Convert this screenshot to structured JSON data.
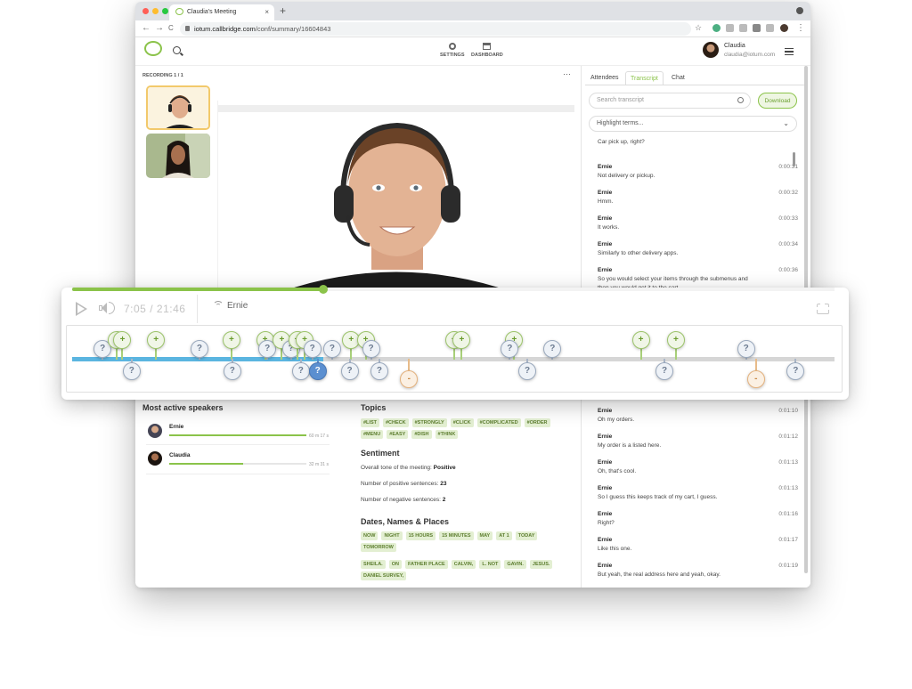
{
  "browser": {
    "tab_title": "Claudia's Meeting",
    "new_tab": "+",
    "url_host": "iotum.callbridge.com",
    "url_path": "/conf/summary/16604843",
    "nav_back": "←",
    "nav_forward": "→",
    "nav_reload": "C",
    "star": "☆",
    "more": "⋮",
    "tab_close": "×"
  },
  "header": {
    "settings_label": "SETTINGS",
    "dashboard_label": "DASHBOARD",
    "user_name": "Claudia",
    "user_email": "claudia@iotum.com"
  },
  "recording": {
    "label": "RECORDING 1 / 1",
    "more": "···"
  },
  "player": {
    "progress": 0.33,
    "current_time": "7:05",
    "separator": "/",
    "total_time": "21:46",
    "current_speaker": "Ernie"
  },
  "timeline": {
    "played_fraction": 0.33,
    "markers": [
      {
        "pos": 0.04,
        "kind": "q",
        "side": "up",
        "level": 1,
        "label": "?"
      },
      {
        "pos": 0.058,
        "kind": "plus",
        "side": "up",
        "level": 2,
        "label": "+"
      },
      {
        "pos": 0.066,
        "kind": "plus",
        "side": "up",
        "level": 2,
        "label": "+"
      },
      {
        "pos": 0.078,
        "kind": "q",
        "side": "down",
        "level": 1,
        "label": "?"
      },
      {
        "pos": 0.11,
        "kind": "plus",
        "side": "up",
        "level": 2,
        "label": "+"
      },
      {
        "pos": 0.167,
        "kind": "q",
        "side": "up",
        "level": 1,
        "label": "?"
      },
      {
        "pos": 0.209,
        "kind": "plus",
        "side": "up",
        "level": 2,
        "label": "+"
      },
      {
        "pos": 0.21,
        "kind": "q",
        "side": "down",
        "level": 1,
        "label": "?"
      },
      {
        "pos": 0.253,
        "kind": "plus",
        "side": "up",
        "level": 2,
        "label": "+"
      },
      {
        "pos": 0.256,
        "kind": "q",
        "side": "up",
        "level": 1,
        "label": "?"
      },
      {
        "pos": 0.275,
        "kind": "plus",
        "side": "up",
        "level": 2,
        "label": "+"
      },
      {
        "pos": 0.287,
        "kind": "q",
        "side": "up",
        "level": 1,
        "label": "?"
      },
      {
        "pos": 0.295,
        "kind": "plus",
        "side": "up",
        "level": 2,
        "label": "+"
      },
      {
        "pos": 0.3,
        "kind": "q",
        "side": "down",
        "level": 1,
        "label": "?"
      },
      {
        "pos": 0.305,
        "kind": "plus",
        "side": "up",
        "level": 2,
        "label": "+"
      },
      {
        "pos": 0.315,
        "kind": "q",
        "side": "up",
        "level": 1,
        "label": "?"
      },
      {
        "pos": 0.322,
        "kind": "sel",
        "side": "down",
        "level": 1,
        "label": "?"
      },
      {
        "pos": 0.341,
        "kind": "q",
        "side": "up",
        "level": 1,
        "label": "?"
      },
      {
        "pos": 0.366,
        "kind": "plus",
        "side": "up",
        "level": 2,
        "label": "+"
      },
      {
        "pos": 0.364,
        "kind": "q",
        "side": "down",
        "level": 1,
        "label": "?"
      },
      {
        "pos": 0.385,
        "kind": "plus",
        "side": "up",
        "level": 2,
        "label": "+"
      },
      {
        "pos": 0.392,
        "kind": "q",
        "side": "up",
        "level": 1,
        "label": "?"
      },
      {
        "pos": 0.403,
        "kind": "q",
        "side": "down",
        "level": 1,
        "label": "?"
      },
      {
        "pos": 0.442,
        "kind": "minus",
        "side": "down",
        "level": 1,
        "label": "-"
      },
      {
        "pos": 0.501,
        "kind": "plus",
        "side": "up",
        "level": 2,
        "label": "+"
      },
      {
        "pos": 0.511,
        "kind": "plus",
        "side": "up",
        "level": 2,
        "label": "+"
      },
      {
        "pos": 0.58,
        "kind": "plus",
        "side": "up",
        "level": 2,
        "label": "+"
      },
      {
        "pos": 0.574,
        "kind": "q",
        "side": "up",
        "level": 1,
        "label": "?"
      },
      {
        "pos": 0.597,
        "kind": "q",
        "side": "down",
        "level": 1,
        "label": "?"
      },
      {
        "pos": 0.63,
        "kind": "q",
        "side": "up",
        "level": 1,
        "label": "?"
      },
      {
        "pos": 0.746,
        "kind": "plus",
        "side": "up",
        "level": 2,
        "label": "+"
      },
      {
        "pos": 0.777,
        "kind": "q",
        "side": "down",
        "level": 1,
        "label": "?"
      },
      {
        "pos": 0.792,
        "kind": "plus",
        "side": "up",
        "level": 2,
        "label": "+"
      },
      {
        "pos": 0.884,
        "kind": "q",
        "side": "up",
        "level": 1,
        "label": "?"
      },
      {
        "pos": 0.897,
        "kind": "minus",
        "side": "down",
        "level": 1,
        "label": "-"
      },
      {
        "pos": 0.949,
        "kind": "q",
        "side": "down",
        "level": 1,
        "label": "?"
      }
    ]
  },
  "transcript": {
    "tabs": [
      "Attendees",
      "Transcript",
      "Chat"
    ],
    "active_tab": 1,
    "search_placeholder": "Search transcript",
    "download_label": "Download",
    "highlight_label": "Highlight terms...",
    "chevron": "⌄",
    "top_entries": [
      {
        "speaker": "",
        "time": "",
        "text": "Car pick up, right?"
      },
      {
        "speaker": "Ernie",
        "time": "0:00:31",
        "text": "Not delivery or pickup."
      },
      {
        "speaker": "Ernie",
        "time": "0:00:32",
        "text": "Hmm."
      },
      {
        "speaker": "Ernie",
        "time": "0:00:33",
        "text": "It works."
      },
      {
        "speaker": "Ernie",
        "time": "0:00:34",
        "text": "Similarly to other delivery apps."
      },
      {
        "speaker": "Ernie",
        "time": "0:00:36",
        "text": "So you would select your items through the submenus and",
        "text2": "then you would get it to the cart."
      }
    ],
    "bottom_entries": [
      {
        "speaker": "Ernie",
        "time": "0:01:10",
        "text": "Oh my orders."
      },
      {
        "speaker": "Ernie",
        "time": "0:01:12",
        "text": "My order is a listed here."
      },
      {
        "speaker": "Ernie",
        "time": "0:01:13",
        "text": "Oh, that's cool."
      },
      {
        "speaker": "Ernie",
        "time": "0:01:13",
        "text": "So I guess this keeps track of my cart, I guess."
      },
      {
        "speaker": "Ernie",
        "time": "0:01:16",
        "text": "Right?"
      },
      {
        "speaker": "Ernie",
        "time": "0:01:17",
        "text": "Like this one."
      },
      {
        "speaker": "Ernie",
        "time": "0:01:19",
        "text": "But yeah, the real address here and yeah, okay."
      }
    ]
  },
  "speakers": {
    "title": "Most active speakers",
    "items": [
      {
        "name": "Ernie",
        "time": "60 m 17 s",
        "share": 1.0
      },
      {
        "name": "Claudia",
        "time": "32 m 31 s",
        "share": 0.54
      }
    ]
  },
  "topics": {
    "title": "Topics",
    "tags": [
      "#LIST",
      "#CHECK",
      "#STRONGLY",
      "#CLICK",
      "#COMPLICATED",
      "#ORDER",
      "#MENU",
      "#EASY",
      "#DISH",
      "#THINK"
    ]
  },
  "sentiment": {
    "title": "Sentiment",
    "tone_label": "Overall tone of the meeting:",
    "tone_value": "Positive",
    "positive_label": "Number of positive sentences:",
    "positive_value": "23",
    "negative_label": "Number of negative sentences:",
    "negative_value": "2"
  },
  "dates": {
    "title": "Dates, Names & Places",
    "tags": [
      "NOW",
      "NIGHT",
      "15 HOURS",
      "15 MINUTES",
      "MAY",
      "AT 1",
      "TODAY",
      "TOMORROW"
    ],
    "names": [
      "SHEILA.",
      "ON",
      "FATHER PLACE",
      "CALVIN,",
      "L. NOT",
      "GAVIN.",
      "JESUS.",
      "DANIEL SURVEY,"
    ]
  },
  "colors": {
    "accent": "#8bc34a",
    "played": "#5bb5e0",
    "selected_marker": "#5b8fd0"
  }
}
